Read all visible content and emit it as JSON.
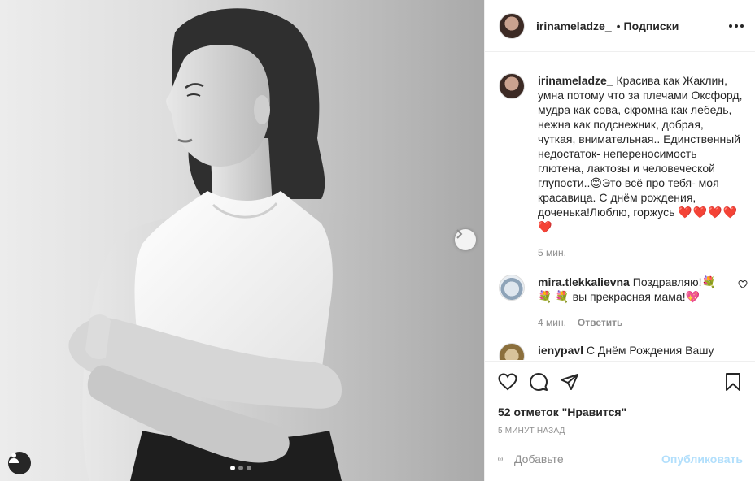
{
  "post": {
    "username": "irinameladze_",
    "separator": "•",
    "follow_label": "Подписки",
    "caption": "Красива как Жаклин, умна потому что за плечами Оксфорд, мудра как сова, скромна как лебедь, нежна как подснежник, добрая, чуткая, внимательная.. Единственный недостаток- непереносимость глютена, лактозы и человеческой глупости..😊Это всё про тебя- моя красавица. С днём рождения, доченька!Люблю, горжусь ",
    "caption_hearts": "❤️❤️❤️❤️❤️",
    "caption_time": "5 мин."
  },
  "comments": [
    {
      "username": "mira.tlekkalievna",
      "text": "Поздравляю!💐 💐 💐 вы прекрасная мама!💖",
      "time": "4 мин.",
      "reply_label": "Ответить"
    },
    {
      "username": "ienypavl",
      "text": "С Днём Рождения Вашу"
    }
  ],
  "actions": {
    "likes_text": "52 отметок \"Нравится\"",
    "time_ago": "5 минут назад"
  },
  "add_comment": {
    "placeholder": "Добавьте",
    "publish_label": "Опубликовать"
  },
  "carousel": {
    "dots": 3,
    "active_index": 0
  },
  "icons": [
    "more-icon",
    "heart-icon",
    "comment-icon",
    "share-icon",
    "bookmark-icon",
    "emoji-icon",
    "user-tag-icon",
    "chevron-right-icon"
  ],
  "colors": {
    "publish_disabled": "#b2dffc",
    "muted": "#8e8e8e",
    "heart": "#ed4956"
  }
}
